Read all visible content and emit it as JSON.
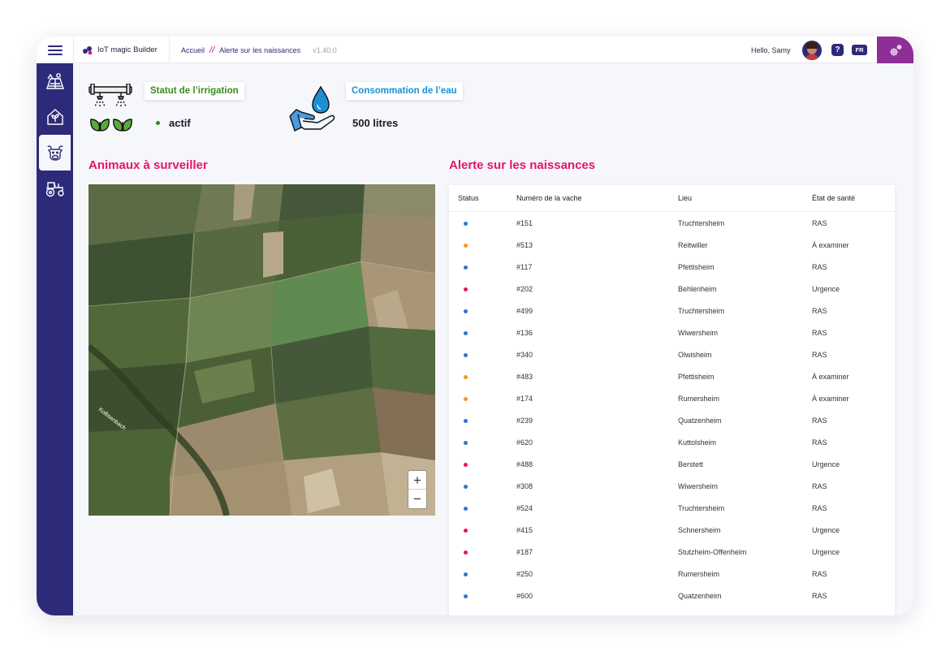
{
  "topbar": {
    "app_name": "IoT magic Builder",
    "breadcrumb_home": "Accueil",
    "breadcrumb_sep": "//",
    "breadcrumb_current": "Alerte sur les naissances",
    "version": "v1.40.0",
    "greeting": "Hello, Samy",
    "help_label": "?",
    "language": "FR"
  },
  "sidebar": {
    "items": [
      {
        "icon": "farm-field-icon",
        "active": false
      },
      {
        "icon": "greenhouse-icon",
        "active": false
      },
      {
        "icon": "cow-icon",
        "active": true
      },
      {
        "icon": "tractor-icon",
        "active": false
      }
    ]
  },
  "irrigation": {
    "title": "Statut de l’irrigation",
    "value": "actif",
    "status_color": "#3a8a1e"
  },
  "water": {
    "title": "Consommation de l’eau",
    "value": "500 litres"
  },
  "animals": {
    "title": "Animaux à surveiller",
    "map_label": "Kolbsenbach",
    "zoom_in": "+",
    "zoom_out": "−"
  },
  "births": {
    "title": "Alerte sur les naissances",
    "columns": [
      "Status",
      "Numéro de la vache",
      "Lieu",
      "État de santé"
    ],
    "status_colors": {
      "RAS": "#2b77d0",
      "À examiner": "#f5961d",
      "Urgence": "#e6145a"
    },
    "rows": [
      {
        "num": "#151",
        "lieu": "Truchtersheim",
        "etat": "RAS"
      },
      {
        "num": "#513",
        "lieu": "Reitwiller",
        "etat": "À examiner"
      },
      {
        "num": "#117",
        "lieu": "Pfettisheim",
        "etat": "RAS"
      },
      {
        "num": "#202",
        "lieu": "Behlenheim",
        "etat": "Urgence"
      },
      {
        "num": "#499",
        "lieu": "Truchtersheim",
        "etat": "RAS"
      },
      {
        "num": "#136",
        "lieu": "Wiwersheim",
        "etat": "RAS"
      },
      {
        "num": "#340",
        "lieu": "Olwisheim",
        "etat": "RAS"
      },
      {
        "num": "#483",
        "lieu": "Pfettisheim",
        "etat": "À examiner"
      },
      {
        "num": "#174",
        "lieu": "Rumersheim",
        "etat": "À examiner"
      },
      {
        "num": "#239",
        "lieu": "Quatzenheim",
        "etat": "RAS"
      },
      {
        "num": "#620",
        "lieu": "Kuttolsheim",
        "etat": "RAS"
      },
      {
        "num": "#488",
        "lieu": "Berstett",
        "etat": "Urgence"
      },
      {
        "num": "#308",
        "lieu": "Wiwersheim",
        "etat": "RAS"
      },
      {
        "num": "#524",
        "lieu": "Truchtersheim",
        "etat": "RAS"
      },
      {
        "num": "#415",
        "lieu": "Schnersheim",
        "etat": "Urgence"
      },
      {
        "num": "#187",
        "lieu": "Stutzheim-Offenheim",
        "etat": "Urgence"
      },
      {
        "num": "#250",
        "lieu": "Rumersheim",
        "etat": "RAS"
      },
      {
        "num": "#600",
        "lieu": "Quatzenheim",
        "etat": "RAS"
      }
    ]
  },
  "colors": {
    "primary": "#2e2a7a",
    "accent_pink": "#e6146e",
    "settings_purple": "#8e2f98"
  }
}
